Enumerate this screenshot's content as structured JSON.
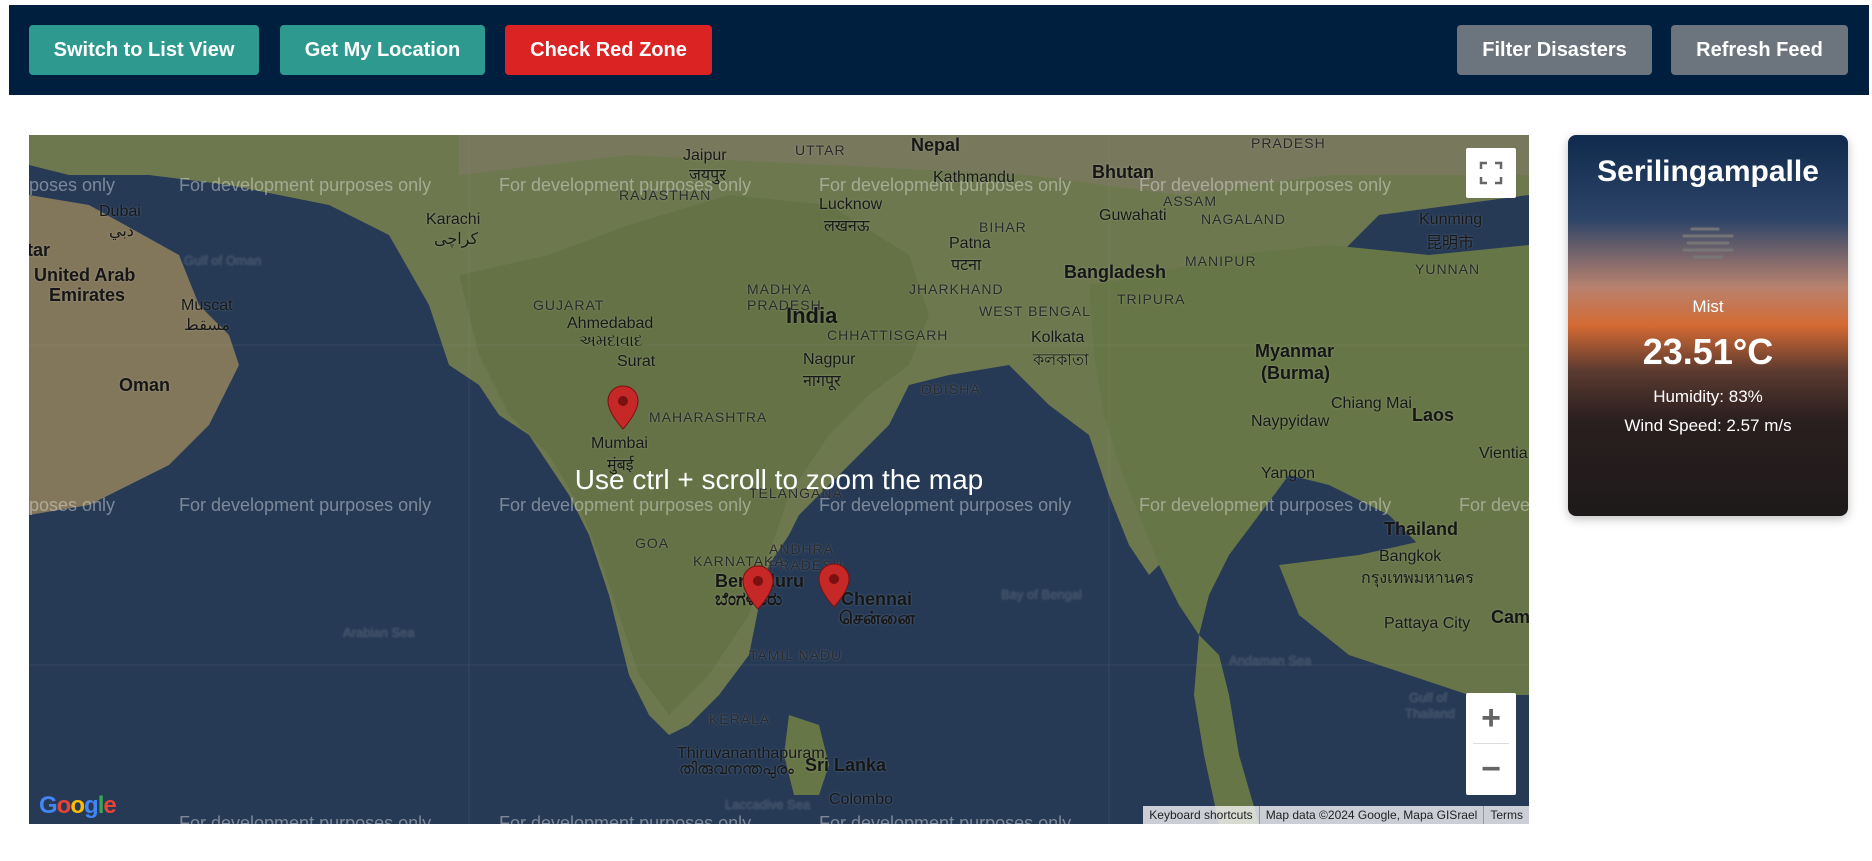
{
  "toolbar": {
    "list_view_label": "Switch to List View",
    "location_label": "Get My Location",
    "red_zone_label": "Check Red Zone",
    "filter_label": "Filter Disasters",
    "refresh_label": "Refresh Feed"
  },
  "map": {
    "watermark": "For development purposes only",
    "watermark_partial_left": "rposes only",
    "watermark_partial_right": "For deve",
    "zoom_hint": "Use ctrl + scroll to zoom the map",
    "zoom_in": "+",
    "zoom_out": "−",
    "logo": "Google",
    "attribution": {
      "shortcuts": "Keyboard shortcuts",
      "data": "Map data ©2024 Google, Mapa GISrael",
      "terms": "Terms"
    },
    "places": {
      "india": "India",
      "nepal": "Nepal",
      "bhutan": "Bhutan",
      "bangladesh": "Bangladesh",
      "myanmar": "Myanmar",
      "myanmar2": "(Burma)",
      "laos": "Laos",
      "thailand": "Thailand",
      "bangkok": "Bangkok",
      "bangkok_local": "กรุงเทพมหานคร",
      "oman": "Oman",
      "muscat": "Muscat",
      "muscat_local": "مسقط",
      "dubai": "Dubai",
      "dubai_local": "دبي",
      "uae1": "United Arab",
      "uae2": "Emirates",
      "karachi": "Karachi",
      "karachi_local": "کراچی",
      "jaipur": "Jaipur",
      "jaipur_local": "जयपुर",
      "kathmandu": "Kathmandu",
      "lucknow": "Lucknow",
      "lucknow_local": "लखनऊ",
      "patna": "Patna",
      "patna_local": "पटना",
      "guwahati": "Guwahati",
      "kunming": "Kunming",
      "kunming_local": "昆明市",
      "ahmedabad": "Ahmedabad",
      "ahmedabad_local": "અમદાવાદ",
      "surat": "Surat",
      "nagpur": "Nagpur",
      "nagpur_local": "नागपूर",
      "kolkata": "Kolkata",
      "kolkata_local": "কলকাতা",
      "mumbai": "Mumbai",
      "mumbai_local": "मुंबई",
      "chiangmai": "Chiang Mai",
      "naypyidaw": "Naypyidaw",
      "yangon": "Yangon",
      "vientiane": "Vientia",
      "bengaluru": "Bengaluru",
      "bengaluru_local": "ಬೆಂಗಳೂರು",
      "chennai": "Chennai",
      "chennai_local": "சென்னை",
      "pattaya": "Pattaya City",
      "thiruvananthapuram": "Thiruvananthapuram",
      "thiruvananthapuram_local": "തിരുവനന്തപുരം",
      "srilanka": "Sri Lanka",
      "colombo": "Colombo",
      "cam": "Cam",
      "tar": "tar",
      "regions": [
        "UTTAR",
        "PRADESH",
        "RAJASTHAN",
        "BIHAR",
        "MADHYA",
        "PRADESH",
        "GUJARAT",
        "JHARKHAND",
        "CHHATTISGARH",
        "WEST BENGAL",
        "ODISHA",
        "MAHARASHTRA",
        "TRIPURA",
        "MANIPUR",
        "NAGALAND",
        "ASSAM",
        "YUNNAN",
        "TELANGANA",
        "ANDHRA",
        "PRADESH",
        "KARNATAKA",
        "GOA",
        "TAMIL NADU",
        "KERALA",
        "PRADESH"
      ],
      "gulf_oman": "Gulf of Oman",
      "arabian_sea": "Arabian Sea",
      "bay_bengal": "Bay of Bengal",
      "andaman_sea": "Andaman Sea",
      "gulf_thailand1": "Gulf of",
      "gulf_thailand2": "Thailand",
      "laccadive": "Laccadive Sea"
    }
  },
  "weather": {
    "city": "Serilingampalle",
    "description": "Mist",
    "icon": "mist-icon",
    "temperature": "23.51°C",
    "humidity": "Humidity: 83%",
    "wind": "Wind Speed: 2.57 m/s"
  },
  "colors": {
    "topbar": "#001f3f",
    "teal": "#2e9a8f",
    "red": "#dc2323",
    "gray": "#6c757d",
    "marker": "#c62828"
  }
}
